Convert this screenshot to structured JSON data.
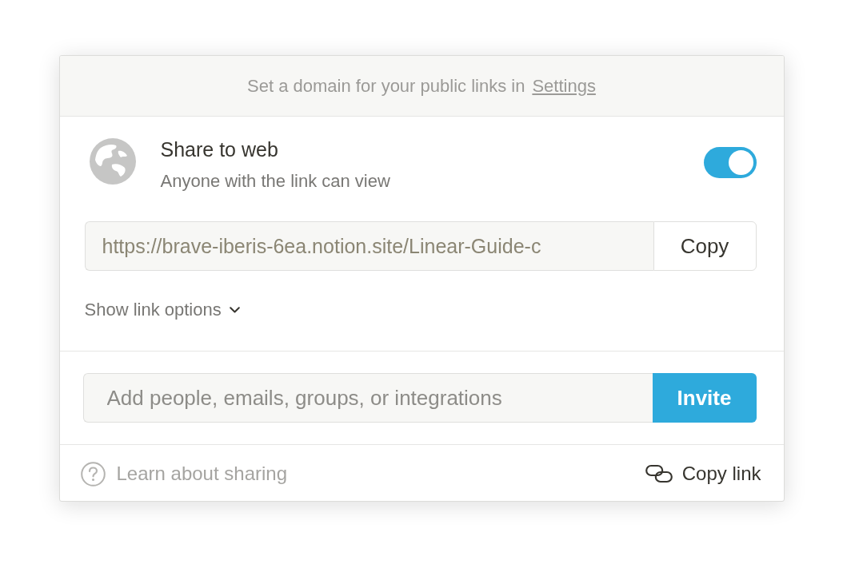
{
  "banner": {
    "text": "Set a domain for your public links in",
    "link": "Settings"
  },
  "share": {
    "title": "Share to web",
    "subtitle": "Anyone with the link can view",
    "on": true
  },
  "link_field": {
    "value": "https://brave-iberis-6ea.notion.site/Linear-Guide-c",
    "button": "Copy"
  },
  "link_options": {
    "label": "Show link options",
    "expanded": false
  },
  "invite": {
    "placeholder": "Add people, emails, groups, or integrations",
    "button": "Invite"
  },
  "footer": {
    "help": "Learn about sharing",
    "copy_link": "Copy link"
  }
}
